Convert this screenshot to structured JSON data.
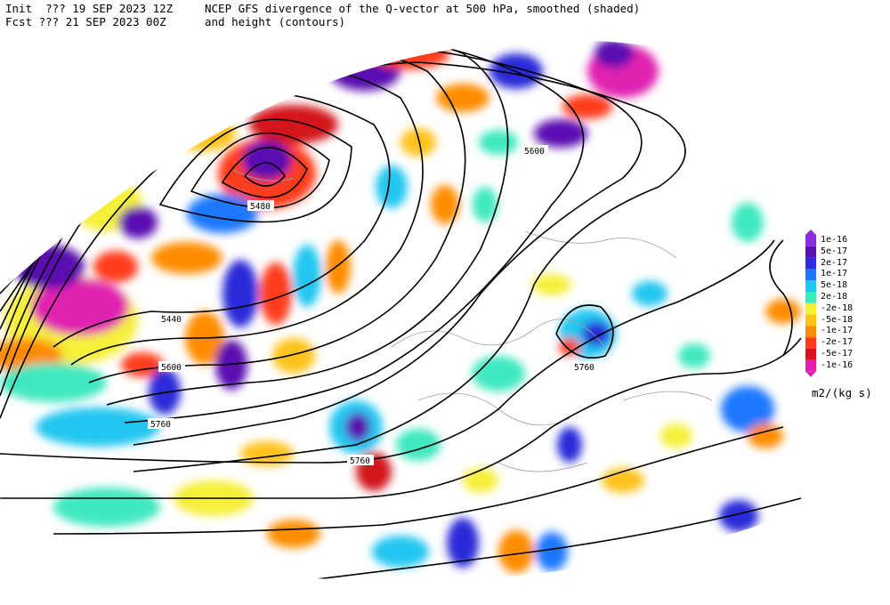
{
  "header": {
    "init_line": "Init  ??? 19 SEP 2023 12Z",
    "fcst_line": "Fcst ??? 21 SEP 2023 00Z",
    "title_line1": "NCEP GFS divergence of the Q-vector at 500 hPa, smoothed (shaded)",
    "title_line2": "and height (contours)"
  },
  "legend": {
    "units": "m2/(kg s)",
    "entries": [
      {
        "label": "1e-16",
        "color": "#8a2be2"
      },
      {
        "label": "5e-17",
        "color": "#5a10b0"
      },
      {
        "label": "2e-17",
        "color": "#2c2cd8"
      },
      {
        "label": "1e-17",
        "color": "#1e78ff"
      },
      {
        "label": "5e-18",
        "color": "#22c6f0"
      },
      {
        "label": "2e-18",
        "color": "#40e8c0"
      },
      {
        "label": "-2e-18",
        "color": "#f6f03a"
      },
      {
        "label": "-5e-18",
        "color": "#ffc31e"
      },
      {
        "label": "-1e-17",
        "color": "#ff8c00"
      },
      {
        "label": "-2e-17",
        "color": "#ff3c1e"
      },
      {
        "label": "-5e-17",
        "color": "#d2141e"
      },
      {
        "label": "-1e-16",
        "color": "#e020b0"
      }
    ]
  },
  "contour_labels": [
    "5600",
    "5480",
    "5440",
    "5600",
    "5760",
    "5760",
    "5760"
  ],
  "colors": {
    "contour": "#000000",
    "coastline": "#a0a0a0",
    "map_background": "#ffffff"
  }
}
